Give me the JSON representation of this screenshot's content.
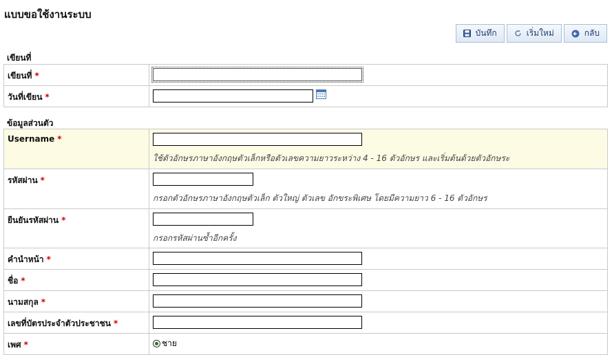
{
  "page": {
    "title": "แบบขอใช้งานระบบ"
  },
  "toolbar": {
    "save_label": "บันทึก",
    "reset_label": "เริ่มใหม่",
    "back_label": "กลับ"
  },
  "sections": {
    "document": "เขียนที่",
    "personal": "ข้อมูลส่วนตัว"
  },
  "fields": {
    "written_at": {
      "label": "เขียนที่",
      "value": ""
    },
    "written_date": {
      "label": "วันที่เขียน",
      "value": ""
    },
    "username": {
      "label": "Username",
      "value": "",
      "hint": "ใช้ตัวอักษรภาษาอังกฤษตัวเล็กหรือตัวเลขความยาวระหว่าง 4 - 16 ตัวอักษร และเริ่มต้นด้วยตัวอักษระ"
    },
    "password": {
      "label": "รหัสผ่าน",
      "value": "",
      "hint": "กรอกตัวอักษรภาษาอังกฤษตัวเล็ก ตัวใหญ่ ตัวเลข อักขระพิเศษ โดยมีความยาว 6 - 16 ตัวอักษร"
    },
    "confirm_password": {
      "label": "ยืนยันรหัสผ่าน",
      "value": "",
      "hint": "กรอกรหัสผ่านซ้ำอีกครั้ง"
    },
    "prefix": {
      "label": "คำนำหน้า",
      "value": ""
    },
    "first_name": {
      "label": "ชื่อ",
      "value": ""
    },
    "last_name": {
      "label": "นามสกุล",
      "value": ""
    },
    "citizen_id": {
      "label": "เลขที่บัตรประจำตัวประชาชน",
      "value": ""
    },
    "gender": {
      "label": "เพศ",
      "selected_option": "ชาย"
    }
  },
  "required_mark": "*",
  "colors": {
    "required": "#cc0000",
    "highlight_row": "#fdfbe4",
    "button_text": "#1c3c72"
  }
}
